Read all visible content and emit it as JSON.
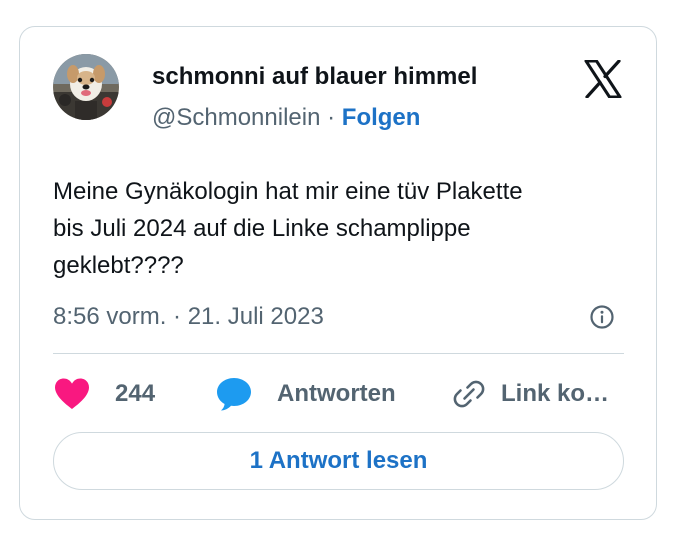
{
  "tweet": {
    "author": {
      "display_name": "schmonni auf blauer himmel",
      "handle": "@Schmonnilein",
      "separator": " · ",
      "follow_label": "Folgen"
    },
    "text": "Meine Gynäkologin hat mir eine tüv Plakette\nbis Juli 2024 auf die Linke schamplippe\ngeklebt????",
    "timestamp": "8:56 vorm. · 21. Juli 2023",
    "actions": {
      "like_count": "244",
      "reply_label": "Antworten",
      "copy_link_label": "Link ko…"
    },
    "read_replies_label": "1 Antwort lesen"
  },
  "icons": {
    "brand": "x-logo-icon",
    "info": "info-icon",
    "like": "heart-icon",
    "reply": "speech-bubble-icon",
    "copy_link": "link-icon"
  },
  "colors": {
    "link_blue": "#1d72c6",
    "like_pink": "#f91880",
    "reply_blue": "#1d9bf0",
    "text_primary": "#0f1419",
    "text_secondary": "#536471",
    "border": "#cfd9de"
  }
}
